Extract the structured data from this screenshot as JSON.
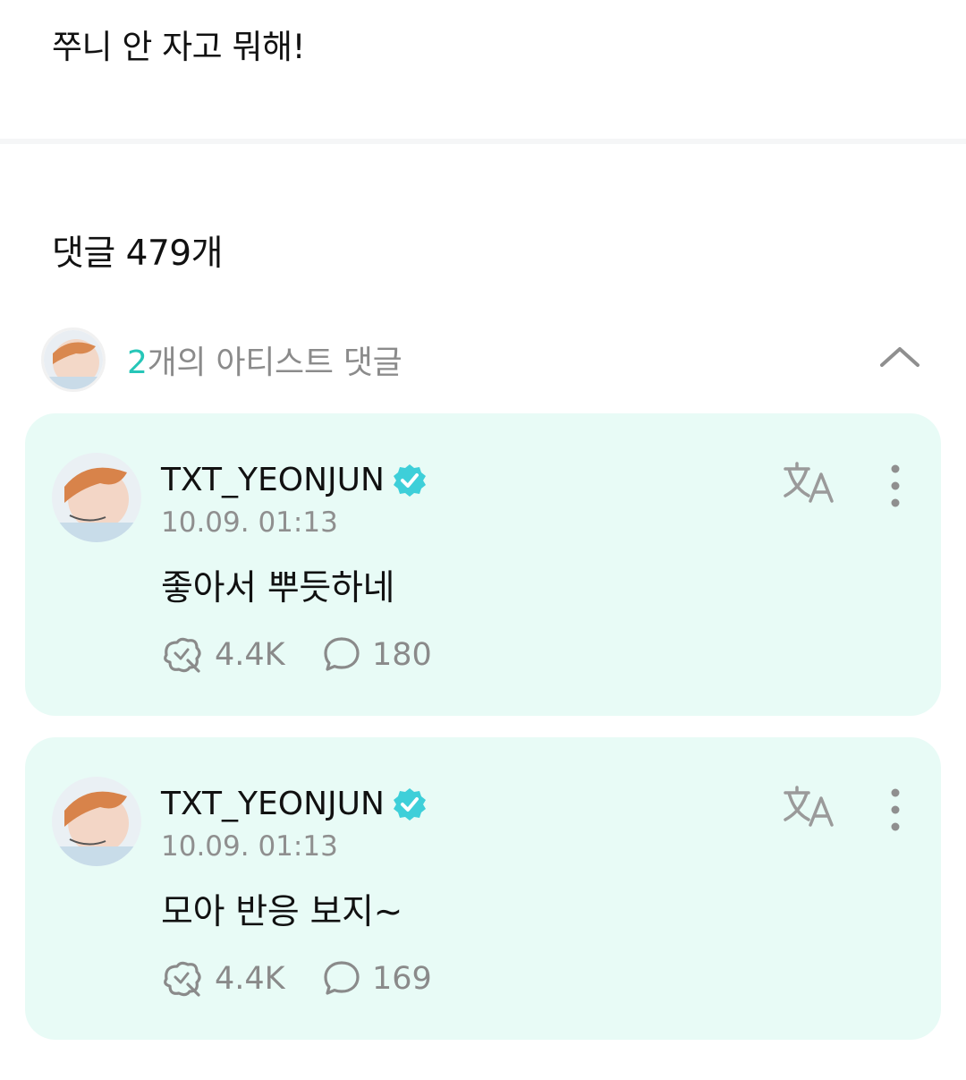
{
  "post": {
    "text": "쭈니 안 자고 뭐해!"
  },
  "comments_header": {
    "label": "댓글 479개"
  },
  "artist_comments": {
    "count": "2",
    "label_suffix": "개의 아티스트 댓글",
    "icons": {
      "collapse": "chevron-up-icon"
    }
  },
  "comments": [
    {
      "author": "TXT_YEONJUN",
      "timestamp": "10.09. 01:13",
      "text": "좋아서 뿌듯하네",
      "likes": "4.4K",
      "replies": "180"
    },
    {
      "author": "TXT_YEONJUN",
      "timestamp": "10.09. 01:13",
      "text": "모아 반응 보지~",
      "likes": "4.4K",
      "replies": "169"
    }
  ],
  "colors": {
    "accent": "#26c6b8",
    "card_bg": "#e8fbf6",
    "verified": "#3ecfd9",
    "muted": "#8b8b8b"
  }
}
